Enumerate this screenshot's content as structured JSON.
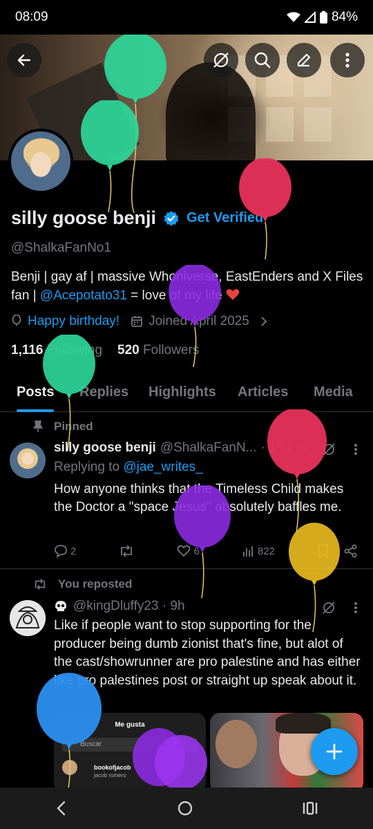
{
  "status": {
    "time": "08:09",
    "battery": "84%"
  },
  "profile": {
    "display_name": "silly goose benji",
    "get_verified": "Get Verified",
    "handle": "@ShalkaFanNo1",
    "bio_before": "Benji | gay af | massive Whoniverse, EastEnders and X Files fan | ",
    "bio_mention": "@Acepotato31",
    "bio_after": " = love of my life",
    "birthday": "Happy birthday!",
    "joined": "Joined April 2025",
    "following_count": "1,116",
    "following_label": "Following",
    "followers_count": "520",
    "followers_label": "Followers"
  },
  "tabs": [
    {
      "label": "Posts"
    },
    {
      "label": "Replies"
    },
    {
      "label": "Highlights"
    },
    {
      "label": "Articles"
    },
    {
      "label": "Media"
    }
  ],
  "pinned_post": {
    "pinned_label": "Pinned",
    "name": "silly goose benji",
    "handle": "@ShalkaFanN...",
    "time": "· 15 Feb",
    "replying_label": "Replying to",
    "replying_to": "@jae_writes_",
    "text": "How anyone thinks that the Timeless Child makes the Doctor a \"space Jesus\" absolutely baffles me.",
    "replies": "2",
    "likes": "6",
    "views": "822"
  },
  "repost": {
    "repost_label": "You reposted",
    "handle": "@kingDluffy23 · 9h",
    "text": "Like if people want to stop supporting for the producer being dumb zionist that's fine, but alot of the cast/showrunner are pro palestine and has either like pro palestines post or straight up speak about it.",
    "media_title": "Me gusta",
    "media_search": "Buscar",
    "media_user": "bookofjacob",
    "media_user_sub": "jacob romero"
  },
  "colors": {
    "accent": "#1d9bf0",
    "text": "#e7e9ea",
    "muted": "#71767b",
    "border": "#2f3336"
  },
  "icons": [
    "back-arrow-icon",
    "grok-icon",
    "search-icon",
    "edit-icon",
    "more-icon",
    "verified-icon",
    "balloon-icon",
    "calendar-icon",
    "pin-icon",
    "repost-icon",
    "heart-icon",
    "views-icon",
    "bookmark-icon",
    "share-icon",
    "plus-icon"
  ]
}
